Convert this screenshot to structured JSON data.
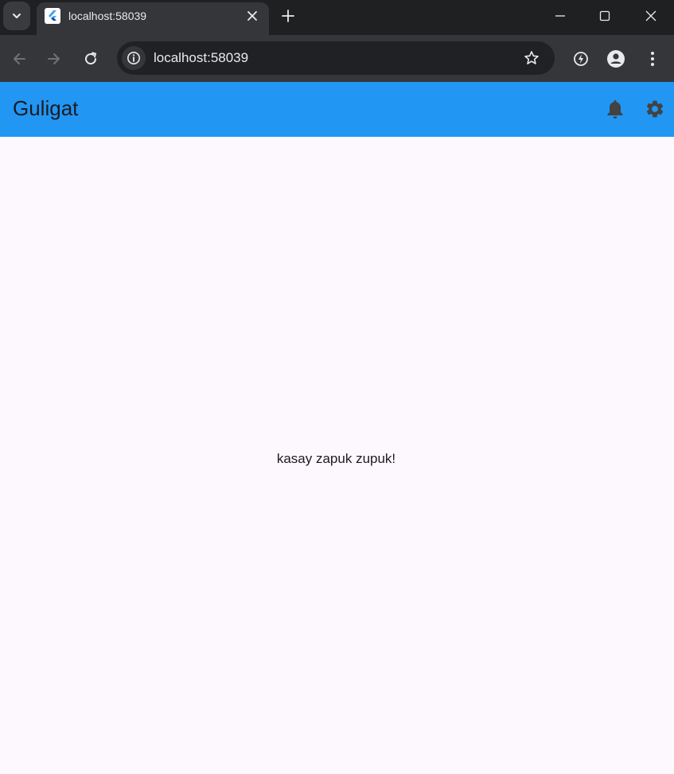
{
  "browser": {
    "tab": {
      "title": "localhost:58039"
    },
    "address_bar": {
      "url": "localhost:58039"
    }
  },
  "app": {
    "title": "Guligat",
    "actions": [
      "notifications-icon",
      "settings-icon"
    ],
    "body_text": "kasay zapuk zupuk!",
    "colors": {
      "app_bar": "#2196f3",
      "background": "#fdf7fe",
      "text": "#1d1b20"
    }
  }
}
